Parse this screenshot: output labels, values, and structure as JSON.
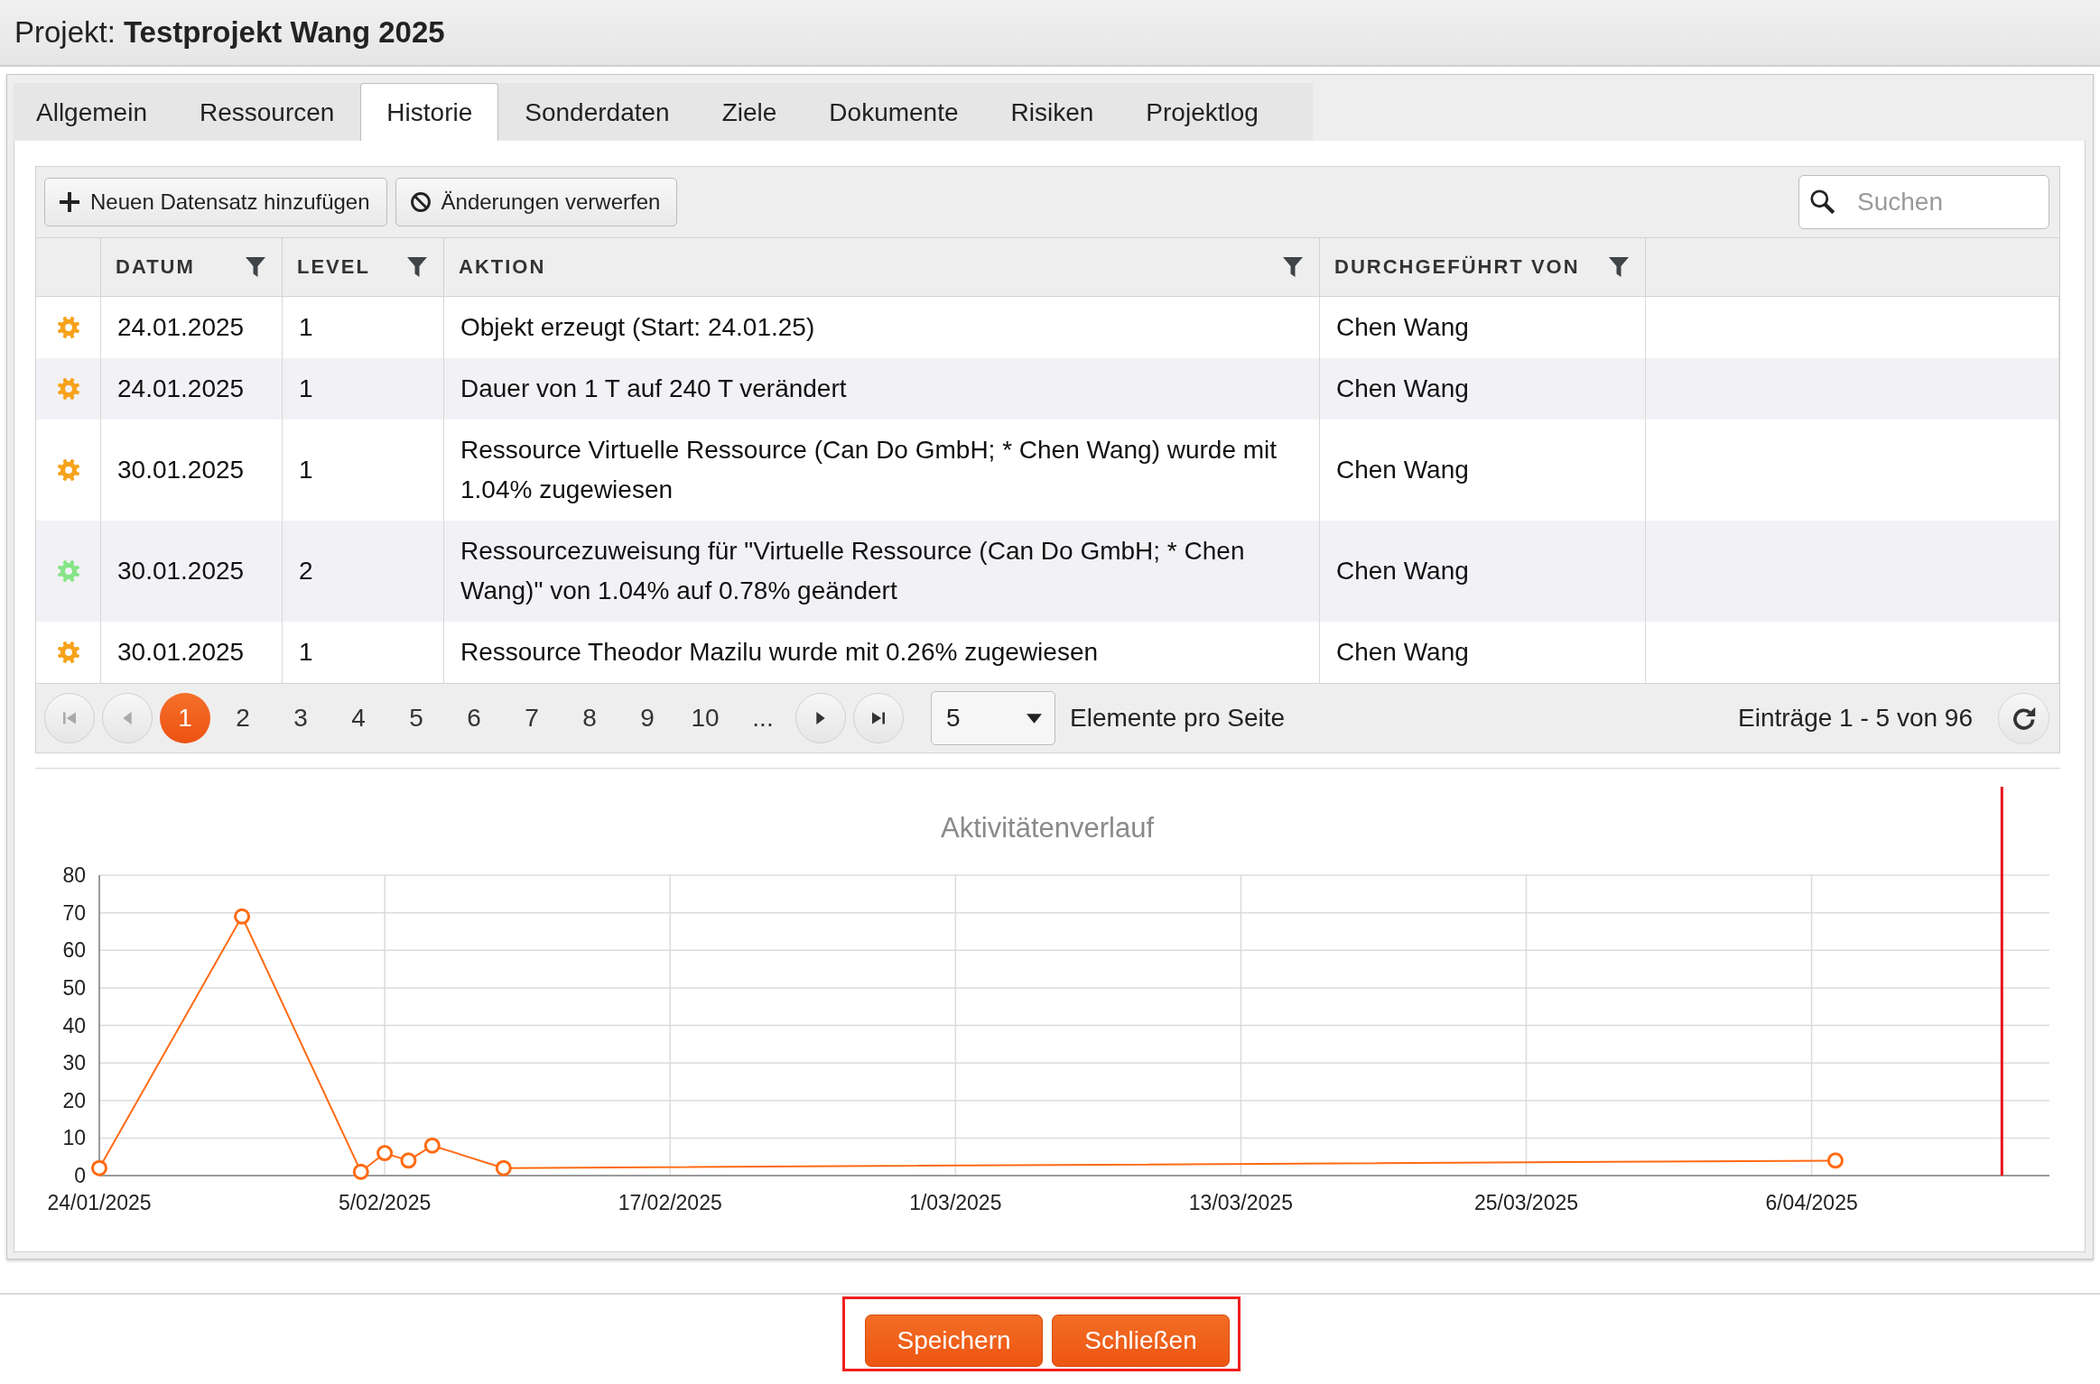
{
  "header": {
    "label": "Projekt:",
    "title": "Testprojekt Wang 2025"
  },
  "tabs": [
    {
      "label": "Allgemein",
      "selected": false
    },
    {
      "label": "Ressourcen",
      "selected": false
    },
    {
      "label": "Historie",
      "selected": true
    },
    {
      "label": "Sonderdaten",
      "selected": false
    },
    {
      "label": "Ziele",
      "selected": false
    },
    {
      "label": "Dokumente",
      "selected": false
    },
    {
      "label": "Risiken",
      "selected": false
    },
    {
      "label": "Projektlog",
      "selected": false
    }
  ],
  "toolbar": {
    "buttons": [
      {
        "kind": "add",
        "label": "Neuen Datensatz hinzufügen"
      },
      {
        "kind": "discard",
        "label": "Änderungen verwerfen"
      }
    ],
    "search": {
      "placeholder": "Suchen"
    }
  },
  "table": {
    "columns": [
      {
        "label": "DATUM",
        "filter": true
      },
      {
        "label": "LEVEL",
        "filter": true
      },
      {
        "label": "AKTION",
        "filter": true
      },
      {
        "label": "DURCHGEFÜHRT VON",
        "filter": true
      }
    ],
    "rows": [
      {
        "color": "#f7a21b",
        "cells": [
          "24.01.2025",
          "1",
          "Objekt erzeugt (Start: 24.01.25)",
          "Chen Wang"
        ]
      },
      {
        "color": "#f7a21b",
        "cells": [
          "24.01.2025",
          "1",
          "Dauer von 1 T auf 240 T verändert",
          "Chen Wang"
        ]
      },
      {
        "color": "#f7a21b",
        "cells": [
          "30.01.2025",
          "1",
          "Ressource Virtuelle Ressource (Can Do GmbH; * Chen Wang) wurde mit 1.04% zugewiesen",
          "Chen Wang"
        ]
      },
      {
        "color": "#86e486",
        "cells": [
          "30.01.2025",
          "2",
          "Ressourcezuweisung für \"Virtuelle Ressource (Can Do GmbH; * Chen Wang)\" von 1.04% auf 0.78% geändert",
          "Chen Wang"
        ]
      },
      {
        "color": "#f7a21b",
        "cells": [
          "30.01.2025",
          "1",
          "Ressource Theodor Mazilu wurde mit 0.26% zugewiesen",
          "Chen Wang"
        ]
      }
    ]
  },
  "pager": {
    "nav_back": [
      {
        "kind": "first",
        "disabled": true
      },
      {
        "kind": "prev",
        "disabled": true
      }
    ],
    "pages": [
      {
        "label": "1",
        "selected": true
      },
      {
        "label": "2",
        "selected": false
      },
      {
        "label": "3",
        "selected": false
      },
      {
        "label": "4",
        "selected": false
      },
      {
        "label": "5",
        "selected": false
      },
      {
        "label": "6",
        "selected": false
      },
      {
        "label": "7",
        "selected": false
      },
      {
        "label": "8",
        "selected": false
      },
      {
        "label": "9",
        "selected": false
      },
      {
        "label": "10",
        "selected": false
      }
    ],
    "ellipsis": "...",
    "nav_forward": [
      {
        "kind": "next",
        "disabled": false
      },
      {
        "kind": "last",
        "disabled": false
      }
    ],
    "page_size": "5",
    "page_size_label": "Elemente pro Seite",
    "summary": "Einträge 1 - 5 von 96"
  },
  "chart": {
    "chart_data": {
      "type": "line",
      "title": "Aktivitätenverlauf",
      "x": [
        "2025-01-24",
        "2025-01-30",
        "2025-02-04",
        "2025-02-05",
        "2025-02-06",
        "2025-02-07",
        "2025-02-10",
        "2025-04-07"
      ],
      "series": [
        {
          "color": "#ff6a13",
          "marker": "o",
          "values": [
            2,
            69,
            1,
            6,
            4,
            8,
            2,
            4
          ]
        }
      ],
      "xlim": [
        "2025-01-24",
        "2025-04-16"
      ],
      "ylim": [
        0,
        80
      ],
      "xticks": [
        {
          "value": "2025-01-24",
          "label": "24/01/2025"
        },
        {
          "value": "2025-02-05",
          "label": "5/02/2025"
        },
        {
          "value": "2025-02-17",
          "label": "17/02/2025"
        },
        {
          "value": "2025-03-01",
          "label": "1/03/2025"
        },
        {
          "value": "2025-03-13",
          "label": "13/03/2025"
        },
        {
          "value": "2025-03-25",
          "label": "25/03/2025"
        },
        {
          "value": "2025-04-06",
          "label": "6/04/2025"
        }
      ],
      "yticks": [
        0,
        10,
        20,
        30,
        40,
        50,
        60,
        70,
        80
      ],
      "grid": true,
      "ref_lines": [
        {
          "axis": "x",
          "value": "2025-04-14",
          "color": "#e8121b"
        }
      ]
    }
  },
  "footer": {
    "highlighted": true,
    "buttons": [
      {
        "label": "Speichern"
      },
      {
        "label": "Schließen"
      }
    ]
  }
}
